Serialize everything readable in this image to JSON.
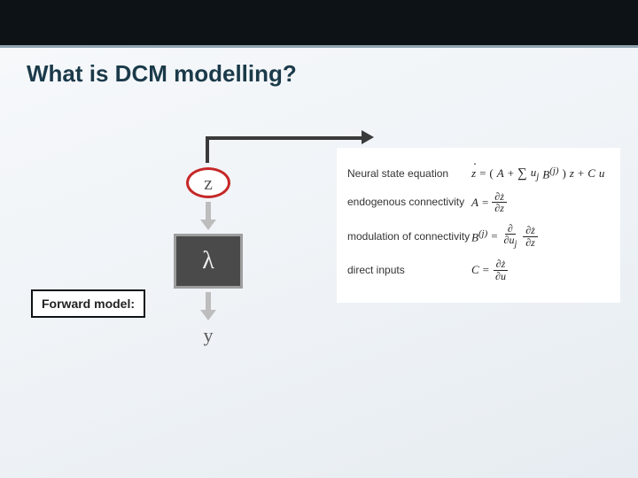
{
  "header": {
    "title": "What is DCM modelling?"
  },
  "labels": {
    "forward_model": "Forward model:"
  },
  "flow": {
    "z": "z",
    "lambda": "λ",
    "y": "y"
  },
  "equations": {
    "state": {
      "label": "Neural state equation",
      "lhs": "ż",
      "eq": "=",
      "open": "(",
      "A": "A",
      "plus": " + ",
      "sigma": "∑",
      "uj": "u",
      "jsub": "j",
      "B": "B",
      "jsup": "(j)",
      "close": ")",
      "z": "z",
      "plus2": " + ",
      "C": "C",
      "u": "u"
    },
    "A": {
      "label": "endogenous connectivity",
      "lhs": "A",
      "eq": "=",
      "num": "∂ż",
      "den": "∂z"
    },
    "B": {
      "label": "modulation of connectivity",
      "lhs": "B",
      "sup": "(j)",
      "eq": "=",
      "outer_num_top": "∂",
      "outer_den": "∂u",
      "outer_den_sub": "j",
      "inner_num": "∂ż",
      "inner_den": "∂z"
    },
    "C": {
      "label": "direct inputs",
      "lhs": "C",
      "eq": "=",
      "num": "∂ż",
      "den": "∂u"
    }
  }
}
